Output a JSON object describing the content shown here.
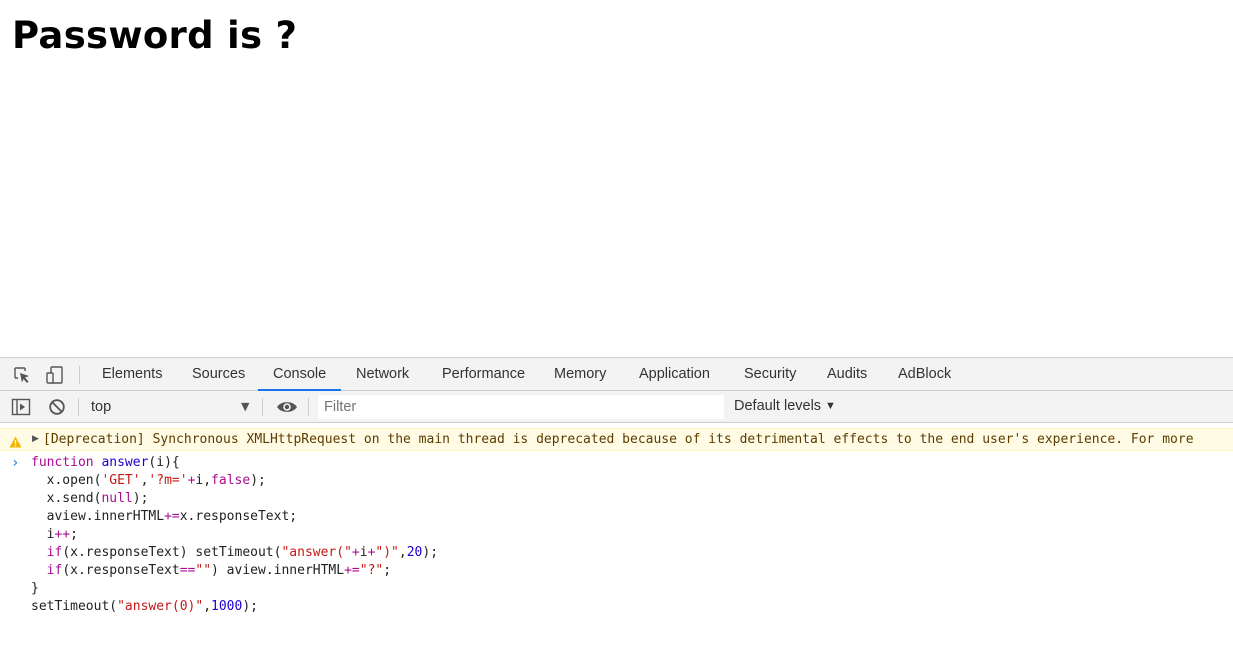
{
  "page": {
    "heading": "Password is ?"
  },
  "devtools": {
    "tabs": [
      {
        "label": "Elements",
        "active": false
      },
      {
        "label": "Sources",
        "active": false
      },
      {
        "label": "Console",
        "active": true
      },
      {
        "label": "Network",
        "active": false
      },
      {
        "label": "Performance",
        "active": false
      },
      {
        "label": "Memory",
        "active": false
      },
      {
        "label": "Application",
        "active": false
      },
      {
        "label": "Security",
        "active": false
      },
      {
        "label": "Audits",
        "active": false
      },
      {
        "label": "AdBlock",
        "active": false
      }
    ],
    "toolbar": {
      "context": "top",
      "filter_placeholder": "Filter",
      "levels_label": "Default levels"
    },
    "icons": {
      "inspect": "element-picker-icon",
      "device": "device-toggle-icon",
      "sidebar": "sidebar-toggle-icon",
      "clear": "clear-console-icon",
      "live": "live-expression-eye-icon",
      "warning": "warning-icon",
      "prompt": "prompt-chevron-icon"
    },
    "console": {
      "warning": "[Deprecation] Synchronous XMLHttpRequest on the main thread is deprecated because of its detrimental effects to the end user's experience. For more",
      "code_lines": [
        "function answer(i){",
        "  x.open('GET','?m='+i,false);",
        "  x.send(null);",
        "  aview.innerHTML+=x.responseText;",
        "  i++;",
        "  if(x.responseText) setTimeout(\"answer(\"+i+\")\",20);",
        "  if(x.responseText==\"\") aview.innerHTML+=\"?\";",
        "}",
        "setTimeout(\"answer(0)\",1000);"
      ]
    },
    "colors": {
      "accent": "#1a73e8",
      "warning_bg": "#fffbe5",
      "warning_text": "#5c3c00",
      "keyword": "#aa0d91",
      "string": "#c41a16",
      "number": "#1c00cf"
    }
  }
}
